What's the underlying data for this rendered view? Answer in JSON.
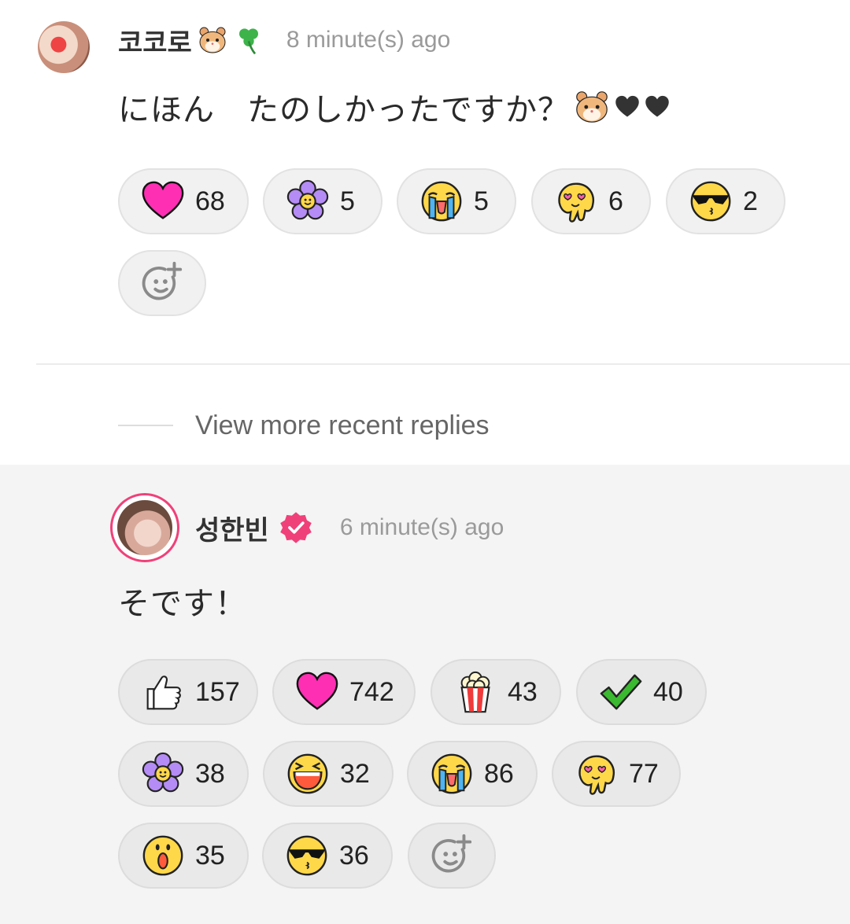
{
  "comment": {
    "author": "코코로",
    "author_emojis": [
      "hamster-icon",
      "shamrock-icon"
    ],
    "time": "8 minute(s) ago",
    "text": "にほん　たのしかったですか？",
    "text_emojis": [
      "hamster-icon",
      "black-heart-icon",
      "black-heart-icon"
    ],
    "reactions": [
      {
        "icon": "pink-heart-icon",
        "count": "68"
      },
      {
        "icon": "purple-flower-icon",
        "count": "5"
      },
      {
        "icon": "crying-face-icon",
        "count": "5"
      },
      {
        "icon": "heart-eyes-melting-face-icon",
        "count": "6"
      },
      {
        "icon": "sunglasses-face-icon",
        "count": "2"
      }
    ]
  },
  "view_more": {
    "label": "View more recent replies"
  },
  "reply": {
    "author": "성한빈",
    "verified": true,
    "time": "6 minute(s) ago",
    "text": "そです！",
    "reactions": [
      {
        "icon": "thumbs-up-icon",
        "count": "157"
      },
      {
        "icon": "pink-heart-icon",
        "count": "742"
      },
      {
        "icon": "popcorn-icon",
        "count": "43"
      },
      {
        "icon": "check-mark-icon",
        "count": "40"
      },
      {
        "icon": "purple-flower-icon",
        "count": "38"
      },
      {
        "icon": "laughing-face-icon",
        "count": "32"
      },
      {
        "icon": "crying-face-icon",
        "count": "86"
      },
      {
        "icon": "heart-eyes-melting-face-icon",
        "count": "77"
      },
      {
        "icon": "surprised-face-icon",
        "count": "35"
      },
      {
        "icon": "sunglasses-face-icon",
        "count": "36"
      }
    ]
  },
  "colors": {
    "accent": "#f0407a",
    "heart": "#ff2fb4",
    "reply_bg": "#f4f4f4"
  }
}
